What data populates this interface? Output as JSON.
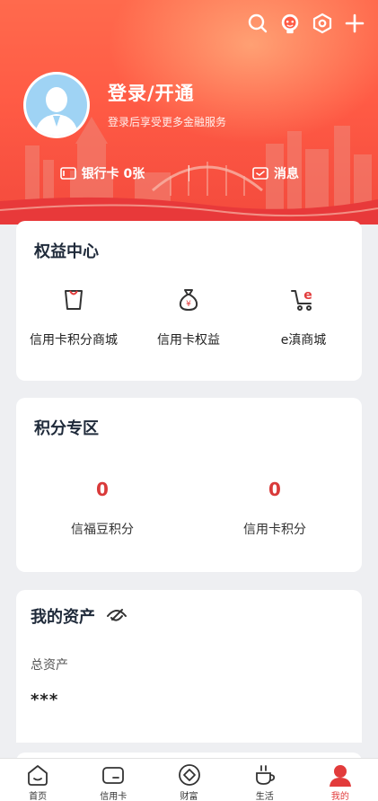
{
  "header": {
    "login_title": "登录/开通",
    "login_subtitle": "登录后享受更多金融服务",
    "bank_card_label": "银行卡 0张",
    "messages_label": "消息",
    "top_icons": [
      "search-icon",
      "customer-service-icon",
      "settings-icon",
      "plus-icon"
    ]
  },
  "benefits": {
    "title": "权益中心",
    "items": [
      {
        "label": "信用卡积分商城",
        "icon": "shopping-bag-icon"
      },
      {
        "label": "信用卡权益",
        "icon": "money-bag-icon"
      },
      {
        "label": "e滇商城",
        "icon": "shopping-cart-icon"
      }
    ]
  },
  "points": {
    "title": "积分专区",
    "items": [
      {
        "value": "0",
        "label": "信福豆积分"
      },
      {
        "value": "0",
        "label": "信用卡积分"
      }
    ]
  },
  "assets": {
    "title": "我的资产",
    "total_label": "总资产",
    "total_value": "***",
    "visibility_icon": "eye-off-icon"
  },
  "tabbar": {
    "items": [
      {
        "label": "首页",
        "icon": "home-icon",
        "active": false
      },
      {
        "label": "信用卡",
        "icon": "credit-card-icon",
        "active": false
      },
      {
        "label": "财富",
        "icon": "wealth-icon",
        "active": false
      },
      {
        "label": "生活",
        "icon": "coffee-cup-icon",
        "active": false
      },
      {
        "label": "我的",
        "icon": "user-icon",
        "active": true
      }
    ]
  },
  "colors": {
    "header": "#ff5b45",
    "accent": "#e23b3b",
    "panel": "#ffffff",
    "background": "#eeeff2"
  }
}
